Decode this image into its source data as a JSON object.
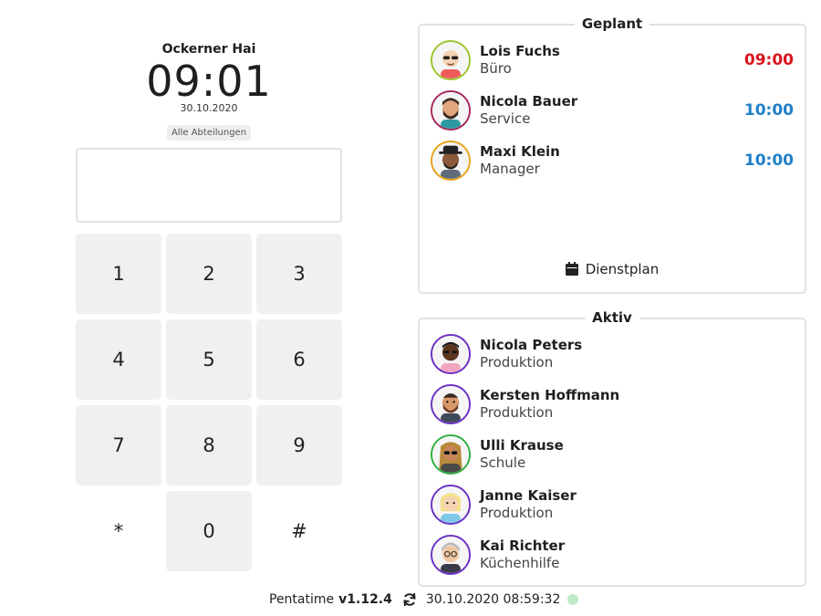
{
  "terminal": {
    "location": "Ockerner Hai",
    "time": "09:01",
    "date": "30.10.2020",
    "department_filter": "Alle Abteilungen",
    "pin_value": ""
  },
  "keypad": {
    "keys": [
      "1",
      "2",
      "3",
      "4",
      "5",
      "6",
      "7",
      "8",
      "9",
      "*",
      "0",
      "#"
    ]
  },
  "planned": {
    "title": "Geplant",
    "schedule_link": "Dienstplan",
    "schedule_icon": "calendar-icon",
    "people": [
      {
        "name": "Lois Fuchs",
        "role": "Büro",
        "time": "09:00",
        "time_color": "#d9141b",
        "ring": "#9cc42a"
      },
      {
        "name": "Nicola Bauer",
        "role": "Service",
        "time": "10:00",
        "time_color": "#1e7fc9",
        "ring": "#a5265c"
      },
      {
        "name": "Maxi Klein",
        "role": "Manager",
        "time": "10:00",
        "time_color": "#1e7fc9",
        "ring": "#e8a118"
      }
    ]
  },
  "active": {
    "title": "Aktiv",
    "people": [
      {
        "name": "Nicola Peters",
        "role": "Produktion",
        "ring": "#6a2fc4"
      },
      {
        "name": "Kersten Hoffmann",
        "role": "Produktion",
        "ring": "#6a2fc4"
      },
      {
        "name": "Ulli Krause",
        "role": "Schule",
        "ring": "#2fae3f"
      },
      {
        "name": "Janne Kaiser",
        "role": "Produktion",
        "ring": "#6a2fc4"
      },
      {
        "name": "Kai Richter",
        "role": "Küchenhilfe",
        "ring": "#6a2fc4"
      }
    ]
  },
  "footer": {
    "app": "Pentatime",
    "version": "v1.12.4",
    "sync_icon": "sync-icon",
    "last_sync": "30.10.2020 08:59:32",
    "status_color": "#bfe9c6"
  }
}
